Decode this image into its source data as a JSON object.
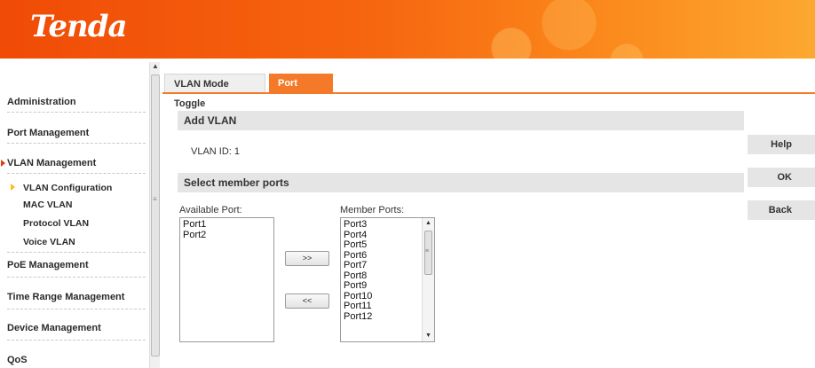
{
  "header": {
    "logo": "Tenda"
  },
  "sidebar": {
    "items": [
      {
        "label": "Administration"
      },
      {
        "label": "Port Management"
      },
      {
        "label": "VLAN Management"
      },
      {
        "label": "PoE Management"
      },
      {
        "label": "Time Range Management"
      },
      {
        "label": "Device Management"
      },
      {
        "label": "QoS"
      }
    ],
    "sub_items": [
      {
        "label": "VLAN Configuration"
      },
      {
        "label": "MAC VLAN"
      },
      {
        "label": "Protocol VLAN"
      },
      {
        "label": "Voice VLAN"
      }
    ]
  },
  "tabs": [
    {
      "label": "VLAN Mode Toggle"
    },
    {
      "label": "Port VLAN"
    }
  ],
  "add_vlan": {
    "title": "Add VLAN",
    "vlan_id_text": "VLAN ID: 1"
  },
  "member": {
    "title": "Select member ports",
    "available_label": "Available Port:",
    "member_label": "Member Ports:",
    "available_ports": [
      "Port1",
      "Port2"
    ],
    "member_ports": [
      "Port3",
      "Port4",
      "Port5",
      "Port6",
      "Port7",
      "Port8",
      "Port9",
      "Port10",
      "Port11",
      "Port12"
    ],
    "add_button": ">>",
    "remove_button": "<<"
  },
  "actions": {
    "help": "Help",
    "ok": "OK",
    "back": "Back"
  },
  "colors": {
    "accent": "#f47a2a",
    "header": "#f04b07"
  }
}
